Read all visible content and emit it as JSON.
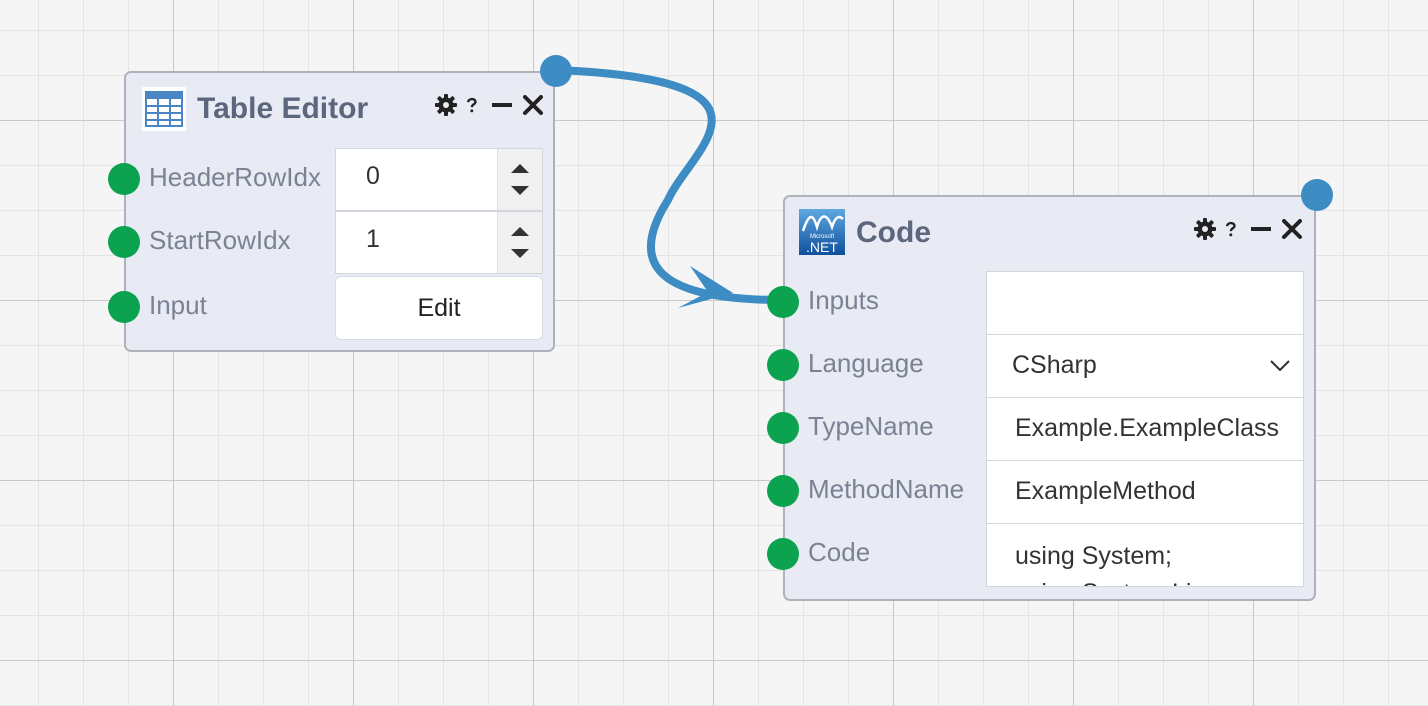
{
  "table_editor": {
    "title": "Table Editor",
    "icon": "table-icon",
    "controls": [
      "gear-icon",
      "help-icon",
      "minimize-icon",
      "close-icon"
    ],
    "rows": [
      {
        "label": "HeaderRowIdx",
        "value": "0"
      },
      {
        "label": "StartRowIdx",
        "value": "1"
      },
      {
        "label": "Input",
        "button": "Edit"
      }
    ]
  },
  "code_node": {
    "title": "Code",
    "icon": "dotnet-icon",
    "icon_text_small": "Microsoft",
    "icon_text": ".NET",
    "controls": [
      "gear-icon",
      "help-icon",
      "minimize-icon",
      "close-icon"
    ],
    "rows": [
      {
        "label": "Inputs",
        "value": ""
      },
      {
        "label": "Language",
        "value": "CSharp"
      },
      {
        "label": "TypeName",
        "value": "Example.ExampleClass"
      },
      {
        "label": "MethodName",
        "value": "ExampleMethod"
      },
      {
        "label": "Code",
        "value": "using System;",
        "value_line2": "using System.Li"
      }
    ]
  },
  "colors": {
    "grid_bg": "#f5f5f5",
    "node_bg": "#e8ebf3",
    "input_port": "#0ba34f",
    "output_port": "#3d8cc4",
    "connection": "#3d8cc4",
    "title_text": "#5c677d"
  }
}
